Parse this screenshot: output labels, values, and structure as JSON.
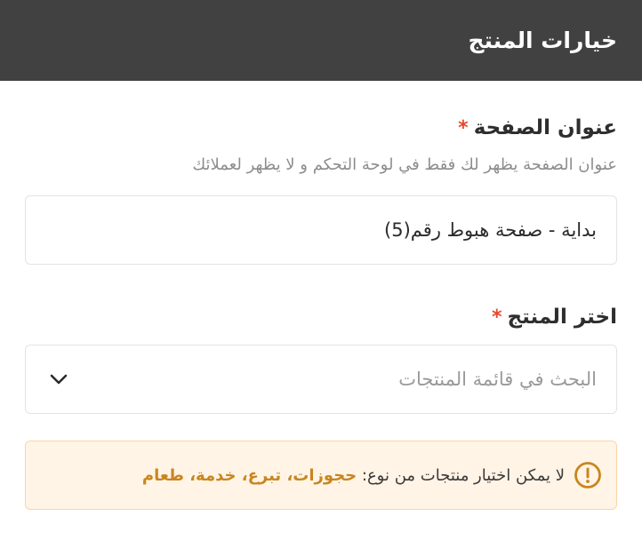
{
  "header": {
    "title": "خيارات المنتج"
  },
  "page_title_field": {
    "label": "عنوان الصفحة",
    "required_mark": "*",
    "hint": "عنوان الصفحة يظهر لك فقط في لوحة التحكم و لا يظهر لعملائك",
    "value": "بداية - صفحة هبوط رقم(5)"
  },
  "product_field": {
    "label": "اختر المنتج",
    "required_mark": "*",
    "placeholder": "البحث في قائمة المنتجات"
  },
  "notice": {
    "prefix": "لا يمكن اختيار منتجات من نوع:",
    "types": "حجوزات، تبرع، خدمة، طعام",
    "icon": "exclamation-circle-icon",
    "color": "#c9861e"
  },
  "colors": {
    "header_bg": "#414141",
    "required": "#e8472d",
    "notice_bg": "#fff4e6",
    "notice_border": "#f9d7a8"
  }
}
